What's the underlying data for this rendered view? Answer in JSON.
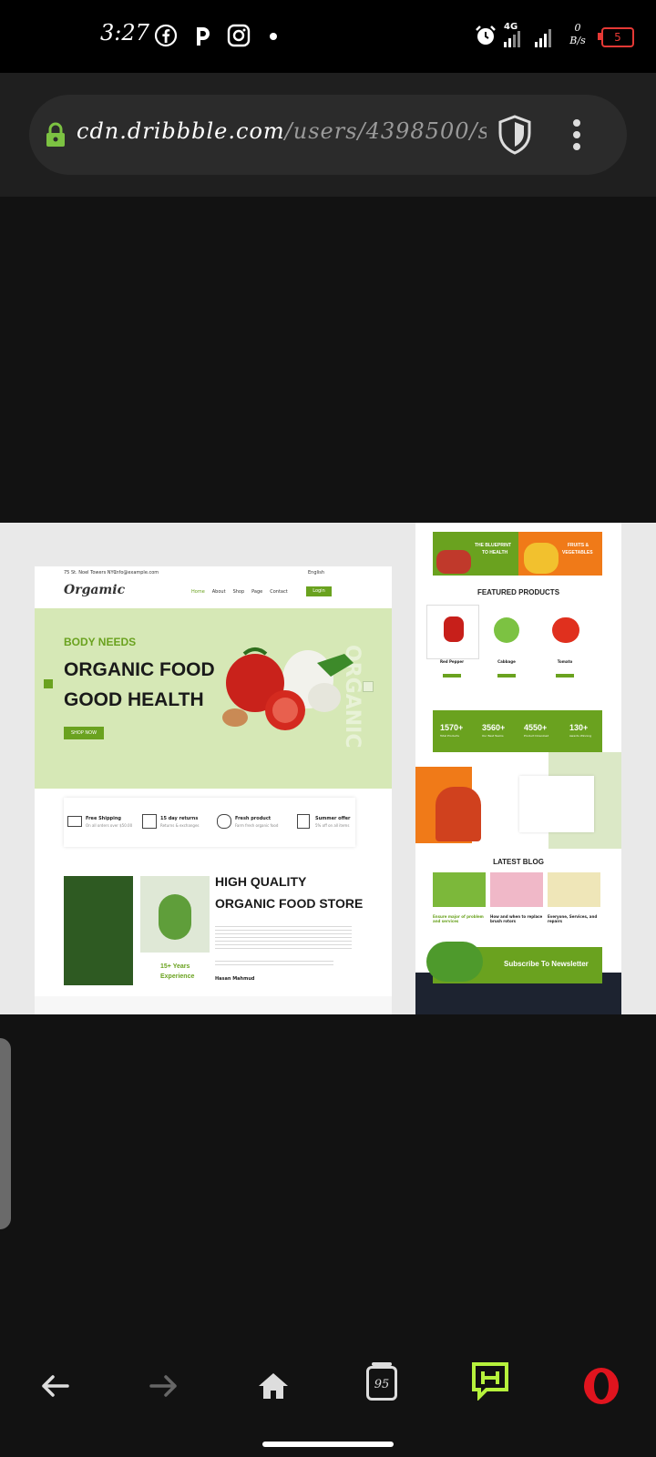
{
  "status_bar": {
    "time": "3:27",
    "network_label": "4G",
    "data_rate_top": "0",
    "data_rate_bottom": "B/s",
    "battery": "5",
    "icons": [
      "facebook-icon",
      "pinterest-icon",
      "instagram-icon",
      "dot-icon",
      "alarm-icon",
      "signal-icon",
      "signal-icon"
    ]
  },
  "browser": {
    "url_host": "cdn.dribbble.com",
    "url_path": "/users/4398500/sc",
    "icons": [
      "lock-icon",
      "shield-icon",
      "more-vert-icon"
    ]
  },
  "mockup": {
    "left_page": {
      "topbar_address": "75 St. Noel Towers NYC",
      "topbar_email": "info@example.com",
      "language": "English",
      "logo": "Orgamic",
      "nav": [
        "Home",
        "About",
        "Shop",
        "Page",
        "Contact"
      ],
      "login": "Login",
      "hero_kicker": "BODY NEEDS",
      "hero_title_1": "ORGANIC FOOD",
      "hero_title_2": "GOOD HEALTH",
      "hero_button": "SHOP NOW",
      "hero_watermark": "ORGANIC",
      "features": [
        {
          "title": "Free Shipping",
          "sub": "On all orders over $50.00"
        },
        {
          "title": "15 day returns",
          "sub": "Returns & exchanges"
        },
        {
          "title": "Fresh product",
          "sub": "Farm fresh organic food"
        },
        {
          "title": "Summer offer",
          "sub": "5% off on all items"
        }
      ],
      "about_title_1": "HIGH QUALITY",
      "about_title_2": "ORGANIC FOOD STORE",
      "experience_num": "15+ Years",
      "experience_label": "Experience",
      "author": "Hasan Mahmud"
    },
    "right_page": {
      "banner_1_line1": "THE BLUEPRINT",
      "banner_1_line2": "TO HEALTH",
      "banner_2_line1": "FRUITS &",
      "banner_2_line2": "VEGETABLES",
      "featured_title": "FEATURED PRODUCTS",
      "products": [
        "Red Pepper",
        "Cabbage",
        "Tomato"
      ],
      "stats": [
        {
          "num": "1570+",
          "label": "Total Products"
        },
        {
          "num": "3560+",
          "label": "Our Best Teams"
        },
        {
          "num": "4550+",
          "label": "Product Download"
        },
        {
          "num": "130+",
          "label": "Awards Winning"
        }
      ],
      "blog_title": "LATEST BLOG",
      "blog_posts": [
        "Ensure major of problem and services",
        "How and when to replace brush rotors",
        "Everyone, Services, and repairs"
      ],
      "newsletter": "Subscribe To Newsletter"
    }
  },
  "bottom_nav": {
    "tabs_count": "95",
    "icons": [
      "back-arrow-icon",
      "forward-arrow-icon",
      "home-icon",
      "tabs-icon",
      "flow-icon",
      "opera-icon"
    ]
  },
  "colors": {
    "accent_green": "#6aa21f",
    "hero_bg": "#d6e8b6",
    "orange": "#f07a18",
    "battery_red": "#e53935"
  }
}
